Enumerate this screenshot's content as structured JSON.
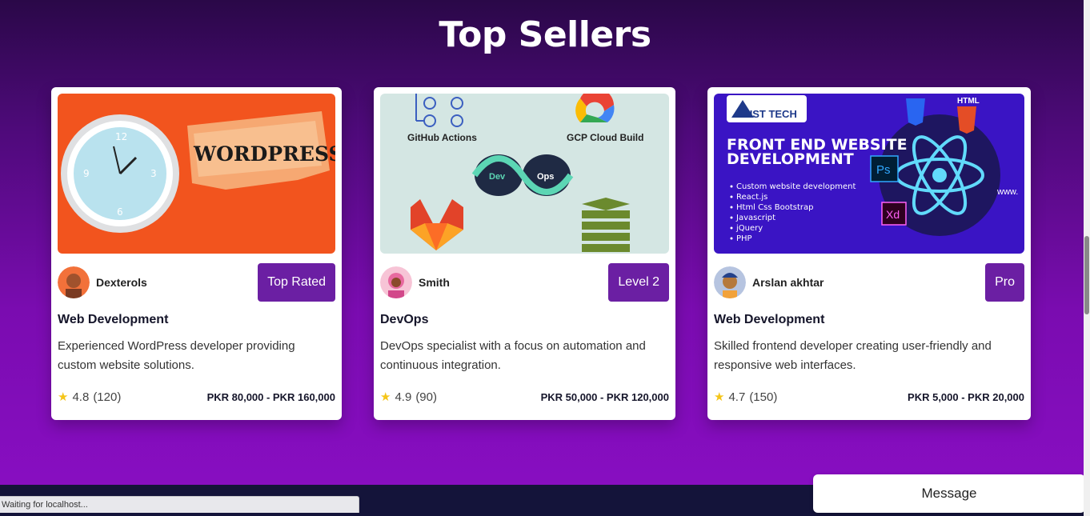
{
  "section": {
    "title": "Top Sellers"
  },
  "cards": [
    {
      "image_alt": "WordPress clock image",
      "seller": "Dexterols",
      "badge": "Top Rated",
      "title": "Web Development",
      "description": "Experienced WordPress developer providing custom website solutions.",
      "rating": "4.8",
      "reviews": "(120)",
      "price": "PKR 80,000 - PKR 160,000",
      "image_text": "WORDPRESS"
    },
    {
      "image_alt": "DevOps tools image",
      "seller": "Smith",
      "badge": "Level 2",
      "title": "DevOps",
      "description": "DevOps specialist with a focus on automation and continuous integration.",
      "rating": "4.9",
      "reviews": "(90)",
      "price": "PKR 50,000 - PKR 120,000",
      "image_labels": {
        "github": "GitHub Actions",
        "gcp": "GCP Cloud Build",
        "dev": "Dev",
        "ops": "Ops"
      }
    },
    {
      "image_alt": "Front end website development image",
      "seller": "Arslan akhtar",
      "badge": "Pro",
      "title": "Web Development",
      "description": "Skilled frontend developer creating user-friendly and responsive web interfaces.",
      "rating": "4.7",
      "reviews": "(150)",
      "price": "PKR 5,000 - PKR 20,000",
      "image_labels": {
        "logo": "MUST TECH",
        "heading1": "FRONT END WEBSITE",
        "heading2": "DEVELOPMENT",
        "bullets": [
          "Custom website development",
          "React.js",
          "Html Css Bootstrap",
          "Javascript",
          "jQuery",
          "PHP"
        ],
        "html": "HTML",
        "ps": "Ps",
        "xd": "Xd",
        "www": "www."
      }
    }
  ],
  "status": {
    "text": "Waiting for localhost..."
  },
  "message_button": {
    "label": "Message"
  },
  "icons": {
    "star": "star-icon"
  },
  "colors": {
    "badge": "#6b1fa3",
    "star": "#f5c518",
    "footer": "#14143a"
  }
}
